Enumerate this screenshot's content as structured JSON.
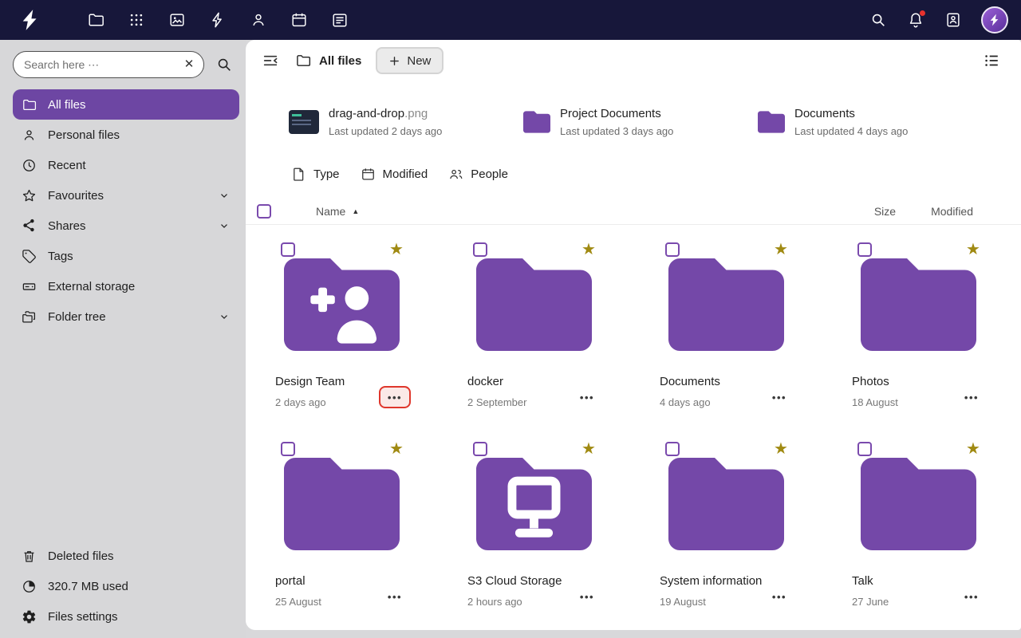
{
  "topbar": {
    "app_icons": [
      {
        "name": "files"
      },
      {
        "name": "dashboard"
      },
      {
        "name": "photos"
      },
      {
        "name": "activity"
      },
      {
        "name": "contacts"
      },
      {
        "name": "calendar"
      },
      {
        "name": "tasks"
      }
    ],
    "right_icons": [
      {
        "name": "unified-search"
      },
      {
        "name": "notifications"
      },
      {
        "name": "contacts-menu"
      },
      {
        "name": "avatar"
      }
    ]
  },
  "sidebar": {
    "search": {
      "placeholder": "Search here ⋯"
    },
    "items": [
      {
        "label": "All files",
        "active": true
      },
      {
        "label": "Personal files"
      },
      {
        "label": "Recent"
      },
      {
        "label": "Favourites",
        "expandable": true
      },
      {
        "label": "Shares",
        "expandable": true
      },
      {
        "label": "Tags"
      },
      {
        "label": "External storage"
      },
      {
        "label": "Folder tree",
        "expandable": true
      }
    ],
    "footer": [
      {
        "label": "Deleted files"
      },
      {
        "label": "320.7 MB used"
      },
      {
        "label": "Files settings"
      }
    ]
  },
  "header": {
    "breadcrumb": "All files",
    "new_button": "New"
  },
  "recent": [
    {
      "name": "drag-and-drop",
      "ext": ".png",
      "subtitle": "Last updated 2 days ago",
      "icon": "image-thumbnail"
    },
    {
      "name": "Project Documents",
      "subtitle": "Last updated 3 days ago",
      "icon": "folder"
    },
    {
      "name": "Documents",
      "subtitle": "Last updated 4 days ago",
      "icon": "folder"
    }
  ],
  "filters": [
    {
      "label": "Type"
    },
    {
      "label": "Modified"
    },
    {
      "label": "People"
    }
  ],
  "table": {
    "columns": {
      "name": "Name",
      "size": "Size",
      "modified": "Modified"
    },
    "sort": "ascending"
  },
  "grid": {
    "items": [
      {
        "name": "Design Team",
        "modified": "2 days ago",
        "icon": "folder-user-plus",
        "favorite": true,
        "actions_highlighted": true
      },
      {
        "name": "docker",
        "modified": "2 September",
        "icon": "folder",
        "favorite": true
      },
      {
        "name": "Documents",
        "modified": "4 days ago",
        "icon": "folder",
        "favorite": true
      },
      {
        "name": "Photos",
        "modified": "18 August",
        "icon": "folder",
        "favorite": true
      },
      {
        "name": "portal",
        "modified": "25 August",
        "icon": "folder",
        "favorite": true
      },
      {
        "name": "S3 Cloud Storage",
        "modified": "2 hours ago",
        "icon": "folder-network",
        "favorite": true
      },
      {
        "name": "System information",
        "modified": "19 August",
        "icon": "folder",
        "favorite": true
      },
      {
        "name": "Talk",
        "modified": "27 June",
        "icon": "folder",
        "favorite": true
      }
    ]
  },
  "colors": {
    "topbar": "#17173a",
    "accent": "#6d46a3",
    "folder": "#7448a8",
    "star": "#a08a12",
    "highlight_red": "#df372c",
    "sidebar_bg": "#d7d7d9"
  }
}
